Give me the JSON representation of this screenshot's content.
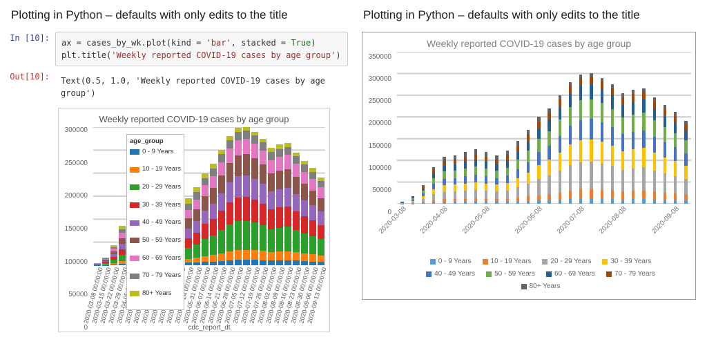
{
  "heading_left": "Plotting in Python – defaults with only edits to the title",
  "heading_right": "Plotting in Python – defaults with only edits to the title",
  "in_label": "In [10]:",
  "out_label": "Out[10]:",
  "code_line1_pre": "ax = cases_by_wk.plot(kind = ",
  "code_line1_arg1": "'bar'",
  "code_line1_mid": ", stacked = ",
  "code_line1_kw": "True",
  "code_line1_post": ")",
  "code_line2_pre": "plt.title(",
  "code_line2_str": "'Weekly reported COVID-19 cases by age group'",
  "code_line2_post": ")",
  "out_text": "Text(0.5, 1.0, 'Weekly reported COVID-19 cases by age group')",
  "legend_header": "age_group",
  "xlabel": "cdc_report_dt",
  "colors": {
    "c0": "#1f77b4",
    "c1": "#ff7f0e",
    "c2": "#2ca02c",
    "c3": "#d62728",
    "c4": "#9467bd",
    "c5": "#8c564b",
    "c6": "#e377c2",
    "c7": "#7f7f7f",
    "c8": "#bcbd22",
    "e0": "#5b9bd5",
    "e1": "#ed7d31",
    "e2": "#a5a5a5",
    "e3": "#ffc000",
    "e4": "#4472c4",
    "e5": "#70ad47",
    "e6": "#255e91",
    "e7": "#9e480e",
    "e8": "#636363"
  },
  "series_labels": [
    "0 - 9 Years",
    "10 - 19 Years",
    "20 - 29 Years",
    "30 - 39 Years",
    "40 - 49 Years",
    "50 - 59 Years",
    "60 - 69 Years",
    "70 - 79 Years",
    "80+ Years"
  ],
  "chart_data": [
    {
      "id": "A",
      "type": "bar",
      "stacked": true,
      "title": "Weekly reported COVID-19 cases by age group",
      "xlabel": "cdc_report_dt",
      "ylabel": "",
      "ylim": [
        0,
        300000
      ],
      "yticks": [
        0,
        50000,
        100000,
        150000,
        200000,
        250000,
        300000
      ],
      "legend_position": "upper-left-inset",
      "series": [
        "0 - 9 Years",
        "10 - 19 Years",
        "20 - 29 Years",
        "30 - 39 Years",
        "40 - 49 Years",
        "50 - 59 Years",
        "60 - 69 Years",
        "70 - 79 Years",
        "80+ Years"
      ],
      "series_colors": [
        "#1f77b4",
        "#ff7f0e",
        "#2ca02c",
        "#d62728",
        "#9467bd",
        "#8c564b",
        "#e377c2",
        "#7f7f7f",
        "#bcbd22"
      ],
      "categories": [
        "2020-03-08 00:00:00",
        "2020-03-15 00:00:00",
        "2020-03-22 00:00:00",
        "2020-03-29 00:00:00",
        "2020-04-05 00:00:00",
        "2020-04-12 00:00:00",
        "2020-04-19 00:00:00",
        "2020-04-26 00:00:00",
        "2020-05-03 00:00:00",
        "2020-05-10 00:00:00",
        "2020-05-17 00:00:00",
        "2020-05-24 00:00:00",
        "2020-05-31 00:00:00",
        "2020-06-07 00:00:00",
        "2020-06-14 00:00:00",
        "2020-06-21 00:00:00",
        "2020-06-28 00:00:00",
        "2020-07-05 00:00:00",
        "2020-07-12 00:00:00",
        "2020-07-19 00:00:00",
        "2020-07-26 00:00:00",
        "2020-08-02 00:00:00",
        "2020-08-09 00:00:00",
        "2020-08-16 00:00:00",
        "2020-08-23 00:00:00",
        "2020-08-30 00:00:00",
        "2020-09-06 00:00:00",
        "2020-09-13 00:00:00"
      ],
      "values": [
        [
          200,
          350,
          800,
          700,
          650,
          700,
          600,
          400,
          400
        ],
        [
          600,
          1200,
          2800,
          2400,
          2400,
          2600,
          2100,
          1500,
          1400
        ],
        [
          1500,
          2800,
          7000,
          6200,
          6100,
          6600,
          5400,
          3800,
          3600
        ],
        [
          3000,
          5500,
          13500,
          12000,
          12000,
          13000,
          11000,
          8000,
          7000
        ],
        [
          3800,
          6800,
          17000,
          15000,
          15000,
          16500,
          14000,
          10500,
          9400
        ],
        [
          4000,
          7000,
          17500,
          15500,
          15500,
          17000,
          14500,
          11000,
          10000
        ],
        [
          4200,
          7200,
          18500,
          16500,
          16500,
          18000,
          15500,
          11800,
          10800
        ],
        [
          4400,
          7500,
          19500,
          17500,
          17500,
          19000,
          16500,
          12700,
          11400
        ],
        [
          4200,
          7200,
          18500,
          16500,
          16500,
          18000,
          15500,
          11800,
          10800
        ],
        [
          4000,
          7000,
          17500,
          15500,
          15500,
          17000,
          14500,
          11000,
          10000
        ],
        [
          4300,
          7400,
          19000,
          17000,
          17000,
          18500,
          16000,
          12300,
          11500
        ],
        [
          5300,
          8800,
          24000,
          21000,
          20500,
          22000,
          18500,
          13700,
          11200
        ],
        [
          6200,
          10500,
          29000,
          25500,
          24500,
          26000,
          21500,
          15300,
          11500
        ],
        [
          7200,
          12500,
          38000,
          32000,
          29500,
          30500,
          24000,
          15800,
          10500
        ],
        [
          8000,
          14000,
          43000,
          36000,
          33000,
          33500,
          26000,
          16500,
          10000
        ],
        [
          9500,
          16500,
          50000,
          42000,
          38000,
          38500,
          29000,
          17500,
          9000
        ],
        [
          11000,
          19500,
          58000,
          48000,
          43000,
          43000,
          31500,
          18000,
          8000
        ],
        [
          12000,
          21500,
          62000,
          51500,
          46000,
          45500,
          33000,
          18500,
          8000
        ],
        [
          12000,
          21500,
          63000,
          52000,
          46500,
          46000,
          33500,
          18500,
          7000
        ],
        [
          11500,
          21000,
          60000,
          50000,
          45000,
          44500,
          32500,
          18000,
          7500
        ],
        [
          11000,
          20000,
          56000,
          47000,
          42500,
          42000,
          31000,
          17500,
          8000
        ],
        [
          10000,
          18500,
          50000,
          42500,
          39000,
          39000,
          29500,
          17000,
          9500
        ],
        [
          10500,
          19000,
          52000,
          44000,
          40000,
          40000,
          30000,
          17200,
          9300
        ],
        [
          11000,
          19500,
          53000,
          44700,
          40500,
          40500,
          30300,
          17500,
          8000
        ],
        [
          10000,
          18000,
          48000,
          41000,
          37500,
          37500,
          28300,
          16500,
          8200
        ],
        [
          9000,
          16500,
          44000,
          37500,
          34500,
          35000,
          26500,
          15700,
          8300
        ],
        [
          8200,
          15500,
          40000,
          34500,
          32000,
          32500,
          25000,
          15000,
          8300
        ],
        [
          7500,
          14000,
          35000,
          31000,
          29000,
          29500,
          23000,
          14000,
          8000
        ]
      ]
    },
    {
      "id": "B",
      "type": "bar",
      "stacked": true,
      "title": "Weekly reported COVID-19 cases by age group",
      "xlabel": "",
      "ylabel": "",
      "ylim": [
        0,
        350000
      ],
      "yticks": [
        0,
        50000,
        100000,
        150000,
        200000,
        250000,
        300000,
        350000
      ],
      "legend_position": "bottom",
      "series": [
        "0 - 9 Years",
        "10 - 19 Years",
        "20 - 29 Years",
        "30 - 39 Years",
        "40 - 49 Years",
        "50 - 59 Years",
        "60 - 69 Years",
        "70 - 79 Years",
        "80+ Years"
      ],
      "series_colors": [
        "#5b9bd5",
        "#ed7d31",
        "#a5a5a5",
        "#ffc000",
        "#4472c4",
        "#70ad47",
        "#255e91",
        "#9e480e",
        "#636363"
      ],
      "categories": [
        "2020-03-08",
        "2020-03-15",
        "2020-03-22",
        "2020-03-29",
        "2020-04-05",
        "2020-04-12",
        "2020-04-19",
        "2020-04-26",
        "2020-05-03",
        "2020-05-10",
        "2020-05-17",
        "2020-05-24",
        "2020-05-31",
        "2020-06-07",
        "2020-06-14",
        "2020-06-21",
        "2020-06-28",
        "2020-07-05",
        "2020-07-12",
        "2020-07-19",
        "2020-07-26",
        "2020-08-02",
        "2020-08-09",
        "2020-08-16",
        "2020-08-23",
        "2020-08-30",
        "2020-09-06",
        "2020-09-13"
      ],
      "categories_shown": [
        "2020-03-08",
        "2020-04-08",
        "2020-05-08",
        "2020-06-08",
        "2020-07-08",
        "2020-08-08",
        "2020-09-08"
      ],
      "values": "same_as_A"
    }
  ]
}
